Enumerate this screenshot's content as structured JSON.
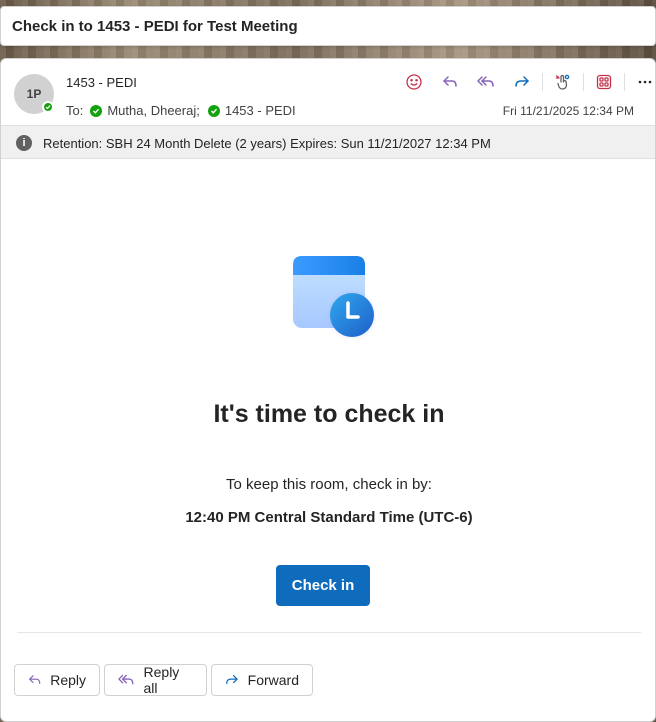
{
  "window": {
    "title": "Check in to 1453 - PEDI for Test Meeting"
  },
  "message": {
    "avatar_initials": "1P",
    "sender": "1453 - PEDI",
    "to_label": "To:",
    "recipients": [
      "Mutha, Dheeraj;",
      "1453 - PEDI"
    ],
    "date": "Fri 11/21/2025 12:34 PM"
  },
  "toolbar": {
    "icons": [
      "emoji-icon",
      "reply-icon",
      "reply-all-icon",
      "forward-icon",
      "touch-icon",
      "apps-icon",
      "more-icon"
    ]
  },
  "retention": {
    "text": "Retention: SBH 24 Month Delete (2 years) Expires: Sun 11/21/2027 12:34 PM"
  },
  "body": {
    "headline": "It's time to check in",
    "instruction": "To keep this room, check in by:",
    "deadline": "12:40 PM Central Standard Time (UTC-6)",
    "checkin_label": "Check in"
  },
  "footer": {
    "reply_label": "Reply",
    "reply_all_label": "Reply all",
    "forward_label": "Forward"
  },
  "colors": {
    "accent": "#0f6cbd",
    "presence": "#13a10e",
    "action_purple": "#8764b8",
    "emoji_red": "#c4314b",
    "forward_blue": "#0f6cbd"
  }
}
